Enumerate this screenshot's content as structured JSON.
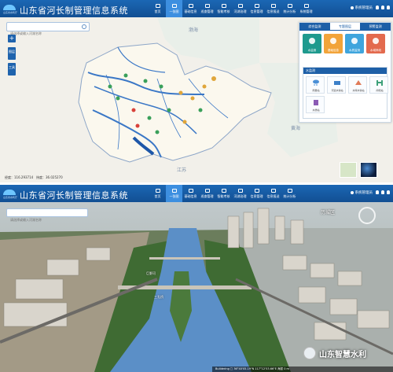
{
  "app": {
    "title": "山东省河长制管理信息系统",
    "brand_sub": "山东省水利厅"
  },
  "nav": [
    {
      "label": "首页"
    },
    {
      "label": "一张图",
      "active": true
    },
    {
      "label": "基础信息"
    },
    {
      "label": "巡查管理"
    },
    {
      "label": "智能考核"
    },
    {
      "label": "河湖治理"
    },
    {
      "label": "信息管理"
    },
    {
      "label": "信息报送"
    },
    {
      "label": "统计分析"
    },
    {
      "label": "系统管理"
    }
  ],
  "user": "系统管理员",
  "search": {
    "placeholder": "请选择或输入河湖名称"
  },
  "side_buttons": [
    "图层",
    "工具"
  ],
  "zoom": {
    "plus": "+"
  },
  "panel": {
    "tabs": [
      "综合监测",
      "专题图层",
      "预警监测"
    ],
    "tiles": [
      {
        "label": "水监测",
        "color": "#1f9a8e"
      },
      {
        "label": "基础信息",
        "color": "#f2a43a"
      },
      {
        "label": "水质监测",
        "color": "#3fa5dd"
      },
      {
        "label": "水域岸线",
        "color": "#e36a4e"
      }
    ],
    "info_title": "水监测",
    "info_items": [
      {
        "label": "雨量站",
        "color": "#4a8fd6"
      },
      {
        "label": "河道水情站",
        "color": "#3b7fc8"
      },
      {
        "label": "水库水情站",
        "color": "#e07b59"
      },
      {
        "label": "闸坝站",
        "color": "#3ea07a"
      },
      {
        "label": "水质站",
        "color": "#8a5ab4"
      }
    ]
  },
  "map_labels": {
    "sea_north": "渤海",
    "sea_east": "黄海",
    "jiangsu": "江苏"
  },
  "status": {
    "lng_label": "经度：",
    "lng": "116.293714",
    "lat_label": "纬度：",
    "lat": "36.025270"
  },
  "scene": {
    "district": "历城区",
    "labels": [
      "巨野河",
      "三孔桥"
    ],
    "status_text": "Buildering    □ 36°40'05.19\"N 117°12'53.66\"E    海拔 0 m"
  },
  "watermark": "山东智慧水利",
  "colors": {
    "topbar": "#1b67b4",
    "river": "#3a77c6",
    "province": "#fbf8ee"
  }
}
